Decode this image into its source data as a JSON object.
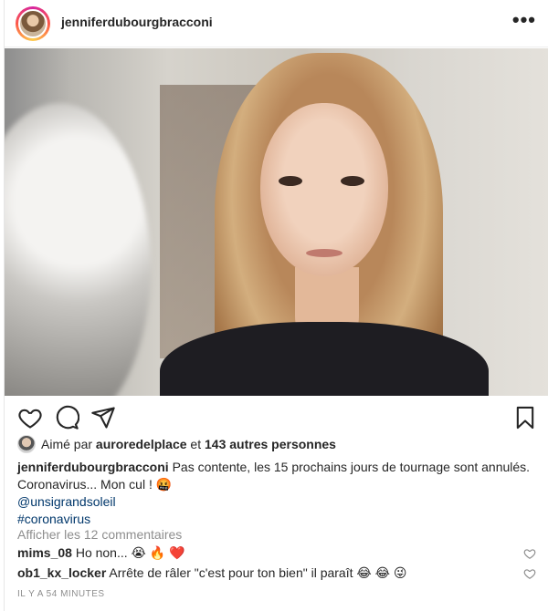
{
  "header": {
    "username": "jenniferdubourgbracconi",
    "more_label": "•••"
  },
  "photo": {
    "alt": ""
  },
  "actions": {
    "icons": [
      "heart-icon",
      "comment-icon",
      "share-icon",
      "bookmark-icon"
    ]
  },
  "likes": {
    "prefix": "Aimé par",
    "liker": "auroredelplace",
    "middle": "et",
    "others": "143 autres personnes"
  },
  "caption": {
    "username": "jenniferdubourgbracconi",
    "text": "Pas contente, les 15 prochains jours de tournage sont annulés. Coronavirus... Mon cul ! 🤬",
    "mention": "@unsigrandsoleil",
    "hashtag": "#coronavirus"
  },
  "view_comments": "Afficher les 12 commentaires",
  "comments": [
    {
      "username": "mims_08",
      "text": "Ho non... 😭 🔥 ❤️"
    },
    {
      "username": "ob1_kx_locker",
      "text": "Arrête de râler \"c'est pour ton bien\" il paraît 😂 😂 😜"
    }
  ],
  "timestamp": "IL Y A 54 MINUTES",
  "colors": {
    "text": "#262626",
    "muted": "#8e8e8e",
    "link": "#00376b"
  }
}
